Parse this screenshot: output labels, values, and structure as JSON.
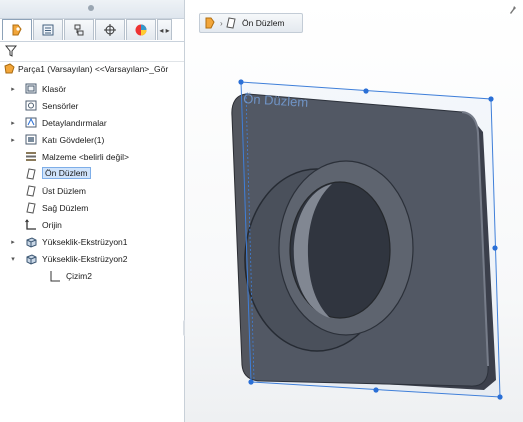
{
  "feature_manager": {
    "tabs": [
      "featuremanager-tab",
      "propertymanager-tab",
      "configuration-tab",
      "dimxpert-tab",
      "display-tab"
    ],
    "tab_scroll": "◂ ▸",
    "root_label": "Parça1 (Varsayılan) <<Varsayılan>_Gör",
    "items": [
      {
        "label": "Klasör",
        "icon": "folder-icon",
        "expand": "▸"
      },
      {
        "label": "Sensörler",
        "icon": "sensor-icon",
        "expand": ""
      },
      {
        "label": "Detaylandırmalar",
        "icon": "annotation-icon",
        "expand": "▸"
      },
      {
        "label": "Katı Gövdeler(1)",
        "icon": "solid-bodies-icon",
        "expand": "▸"
      },
      {
        "label": "Malzeme <belirli değil>",
        "icon": "material-icon",
        "expand": ""
      },
      {
        "label": "Ön Düzlem",
        "icon": "plane-icon",
        "expand": "",
        "selected": true
      },
      {
        "label": "Üst Düzlem",
        "icon": "plane-icon",
        "expand": ""
      },
      {
        "label": "Sağ Düzlem",
        "icon": "plane-icon",
        "expand": ""
      },
      {
        "label": "Orijin",
        "icon": "origin-icon",
        "expand": ""
      },
      {
        "label": "Yükseklik-Ekstrüzyon1",
        "icon": "extrude-icon",
        "expand": "▸"
      },
      {
        "label": "Yükseklik-Ekstrüzyon2",
        "icon": "extrude-icon",
        "expand": "▾"
      },
      {
        "label": "Çizim2",
        "icon": "sketch-icon",
        "expand": "",
        "indent": true
      }
    ]
  },
  "breadcrumb": {
    "label": "Ön Düzlem"
  },
  "viewport": {
    "plane_label": "Ön Düzlem"
  },
  "colors": {
    "accent": "#7eaee8",
    "part": "#4e5058",
    "plane": "#2a6fd6"
  }
}
